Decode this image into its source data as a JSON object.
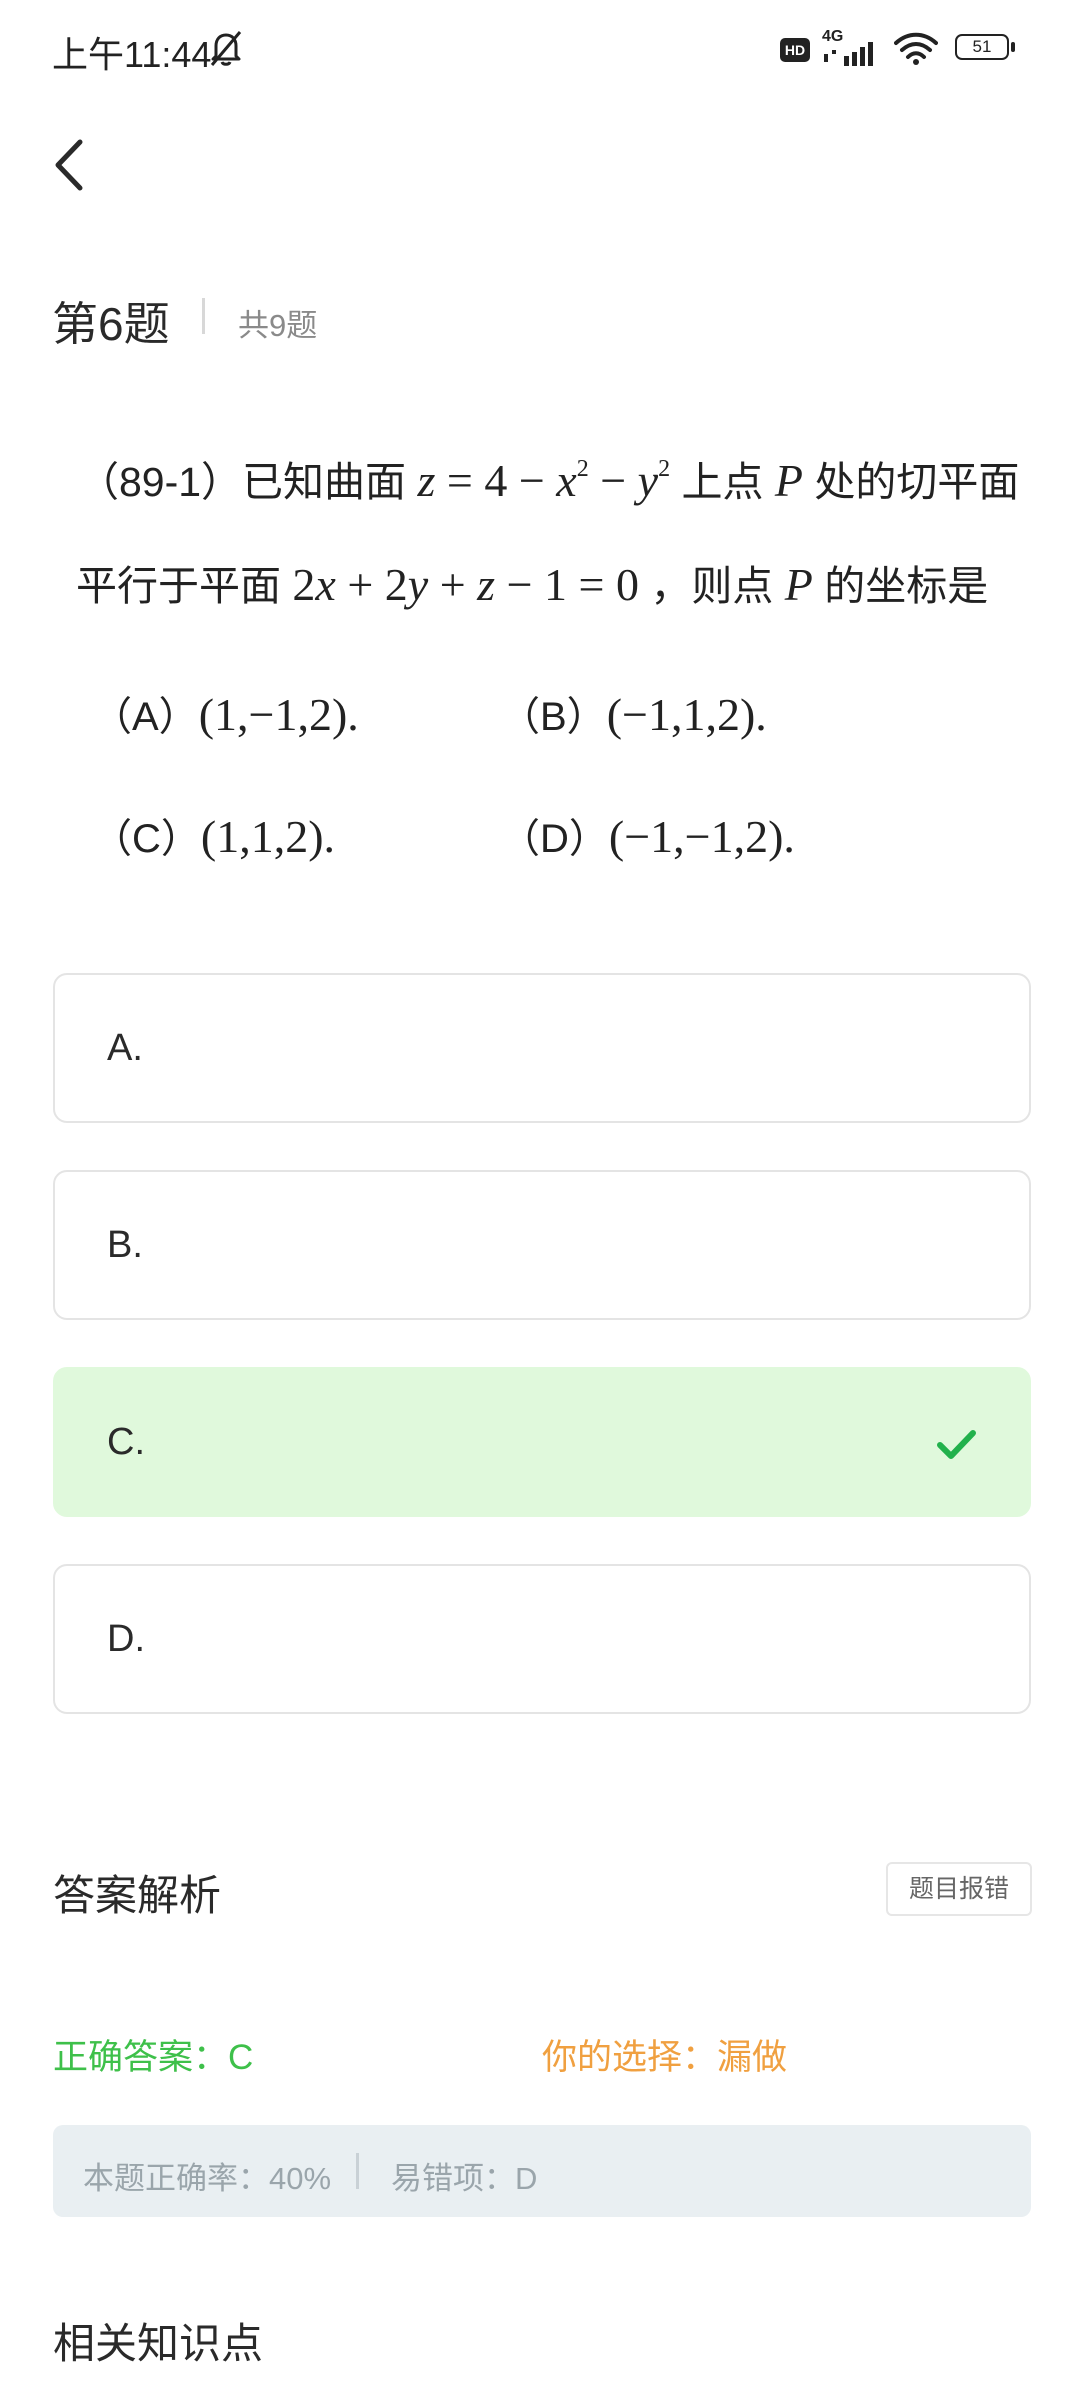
{
  "status_bar": {
    "time": "上午11:44",
    "hd": "HD",
    "network": "4G",
    "battery": "51"
  },
  "question": {
    "number": "第6题",
    "total": "共9题",
    "prefix": "（89-1）已知曲面",
    "mid1": "上点",
    "mid2": "处的切平面",
    "line2_prefix": "平行于平面",
    "line2_mid": "，则点",
    "line2_suffix": "的坐标是",
    "choices": [
      {
        "label": "（A）",
        "value": "(1,−1,2)."
      },
      {
        "label": "（B）",
        "value": "(−1,1,2)."
      },
      {
        "label": "（C）",
        "value": "(1,1,2)."
      },
      {
        "label": "（D）",
        "value": "(−1,−1,2)."
      }
    ]
  },
  "options": [
    {
      "label": "A.",
      "state": "normal"
    },
    {
      "label": "B.",
      "state": "normal"
    },
    {
      "label": "C.",
      "state": "correct"
    },
    {
      "label": "D.",
      "state": "normal"
    }
  ],
  "analysis": {
    "title": "答案解析",
    "report_label": "题目报错",
    "correct_answer": "正确答案：C",
    "your_choice": "你的选择：漏做",
    "accuracy": "本题正确率：40%",
    "common_wrong": "易错项：D"
  },
  "related": {
    "title": "相关知识点"
  },
  "colors": {
    "correct_green": "#3ec04a",
    "choice_orange": "#f0a040",
    "correct_bg": "#e0f9dc",
    "check_green": "#22b14c"
  },
  "icons": [
    "bell-off-icon",
    "signal-icon",
    "wifi-icon",
    "battery-icon",
    "back-arrow-icon",
    "check-icon"
  ]
}
